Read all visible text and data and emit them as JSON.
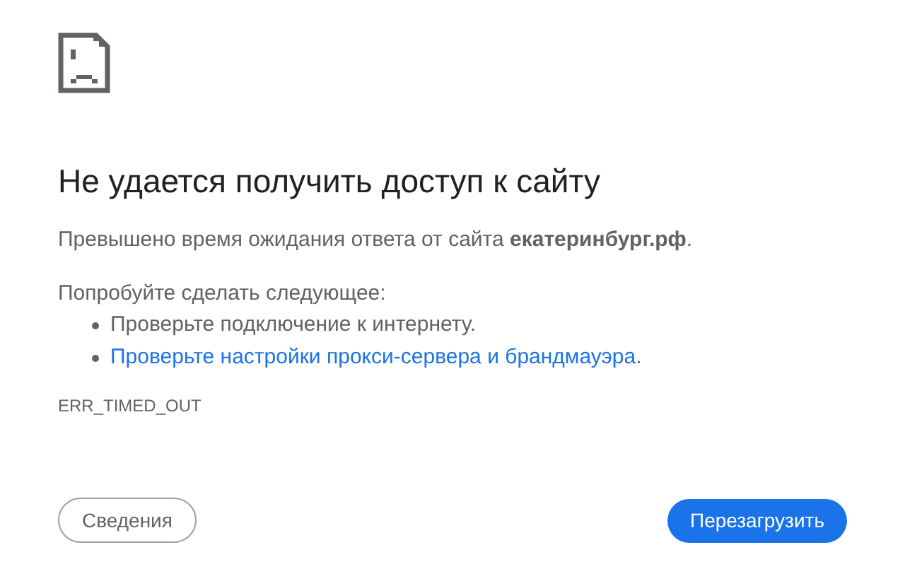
{
  "title": "Не удается получить доступ к сайту",
  "message": "Превышено время ожидания ответа от сайта **екатеринбург.рф**.",
  "suggestions_heading": "Попробуйте сделать следующее:",
  "suggestions": [
    {
      "kind": "text",
      "text": "Проверьте подключение к интернету."
    },
    {
      "kind": "link",
      "text": "Проверьте настройки прокси-сервера и брандмауэра",
      "suffix": "."
    }
  ],
  "error_code": "ERR_TIMED_OUT",
  "buttons": {
    "details": "Сведения",
    "reload": "Перезагрузить"
  }
}
